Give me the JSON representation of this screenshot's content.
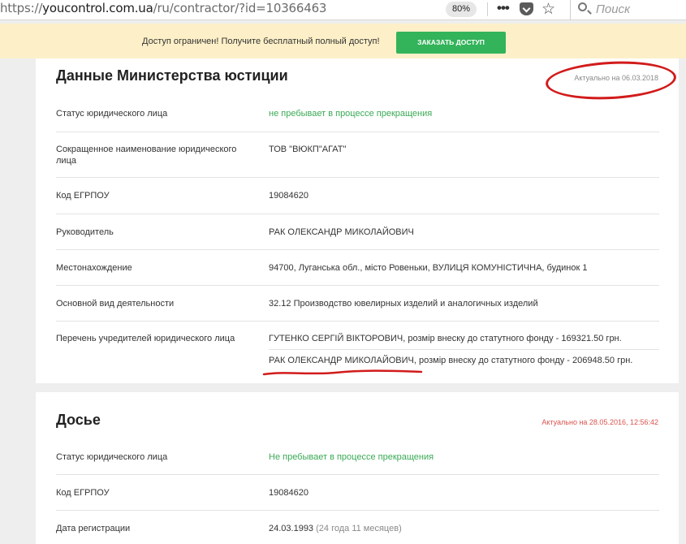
{
  "browser": {
    "url_prefix": "https://",
    "url_host": "youcontrol.com.ua",
    "url_path": "/ru/contractor/?id=10366463",
    "zoom": "80%",
    "search_placeholder": "Поиск"
  },
  "banner": {
    "text": "Доступ ограничен! Получите бесплатный полный доступ!",
    "button_label": "ЗАКАЗАТЬ ДОСТУП"
  },
  "ministry": {
    "title": "Данные Министерства юстиции",
    "actual": "Актуально на 06.03.2018",
    "rows": [
      {
        "label": "Статус юридического лица",
        "value": "не пребывает в процессе прекращения"
      },
      {
        "label": "Сокращенное наименование юридического лица",
        "value": "ТОВ \"ВЮКП\"АГАТ\""
      },
      {
        "label": "Код ЕГРПОУ",
        "value": "19084620"
      },
      {
        "label": "Руководитель",
        "value": "РАК ОЛЕКСАНДР МИКОЛАЙОВИЧ"
      },
      {
        "label": "Местонахождение",
        "value": "94700, Луганська обл., місто Ровеньки, ВУЛИЦЯ КОМУНІСТИЧНА, будинок 1"
      },
      {
        "label": "Основной вид деятельности",
        "value": "32.12 Производство ювелирных изделий и аналогичных изделий"
      },
      {
        "label": "Перечень учредителей юридического лица",
        "value": "ГУТЕНКО СЕРГІЙ ВІКТОРОВИЧ, розмір внеску до статутного фонду - 169321.50 грн.",
        "value2": "РАК ОЛЕКСАНДР МИКОЛАЙОВИЧ, розмір внеску до статутного фонду - 206948.50 грн."
      }
    ]
  },
  "dossier": {
    "title": "Досье",
    "actual": "Актуально на 28.05.2016, 12:56:42",
    "rows": [
      {
        "label": "Статус юридического лица",
        "value": "Не пребывает в процессе прекращения"
      },
      {
        "label": "Код ЕГРПОУ",
        "value": "19084620"
      },
      {
        "label": "Дата регистрации",
        "value": "24.03.1993",
        "note": "(24 года 11 месяцев)"
      }
    ]
  },
  "colors": {
    "accent_green": "#33b35a",
    "status_green": "#3aaa55",
    "alert_red": "#d9534f",
    "annotation_red": "#d21b1b",
    "banner_bg": "#fdf0c8"
  }
}
